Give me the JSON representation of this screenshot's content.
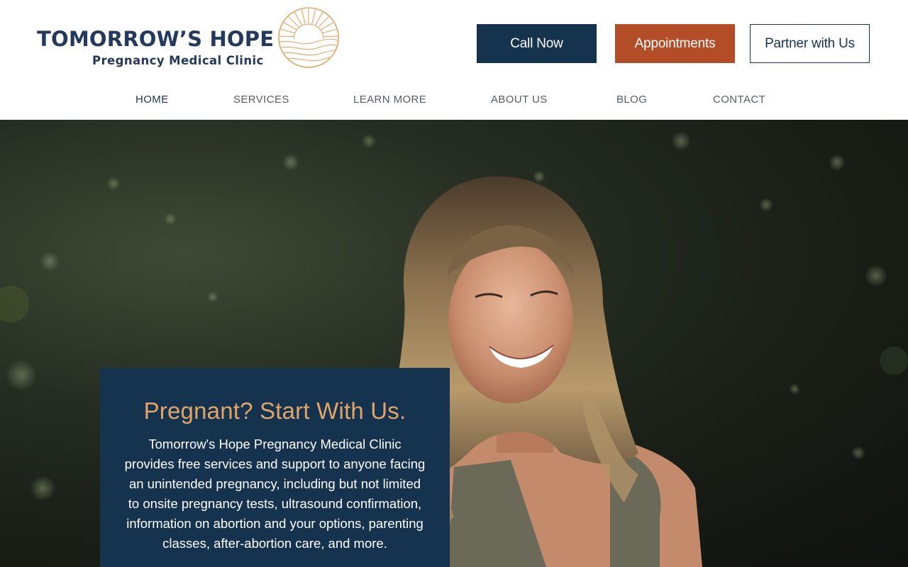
{
  "brand": {
    "name": "TOMORROW’S HOPE",
    "tagline": "Pregnancy Medical Clinic",
    "colors": {
      "navy": "#15324f",
      "rust": "#b24d27",
      "gold": "#e1a566"
    }
  },
  "header": {
    "buttons": {
      "call": "Call Now",
      "appointments": "Appointments",
      "partner": "Partner with Us"
    }
  },
  "nav": {
    "items": [
      {
        "label": "HOME",
        "active": true
      },
      {
        "label": "SERVICES",
        "active": false
      },
      {
        "label": "LEARN MORE",
        "active": false
      },
      {
        "label": "ABOUT US",
        "active": false
      },
      {
        "label": "BLOG",
        "active": false
      },
      {
        "label": "CONTACT",
        "active": false
      }
    ]
  },
  "hero": {
    "image": "smiling-woman-photo",
    "card": {
      "title": "Pregnant? Start With Us.",
      "body": "Tomorrow's Hope Pregnancy Medical Clinic provides free services and support to anyone facing an unintended pregnancy, including but not limited to onsite pregnancy tests, ultrasound confirmation, information on abortion and your options, parenting classes, after-abortion care, and more."
    }
  }
}
